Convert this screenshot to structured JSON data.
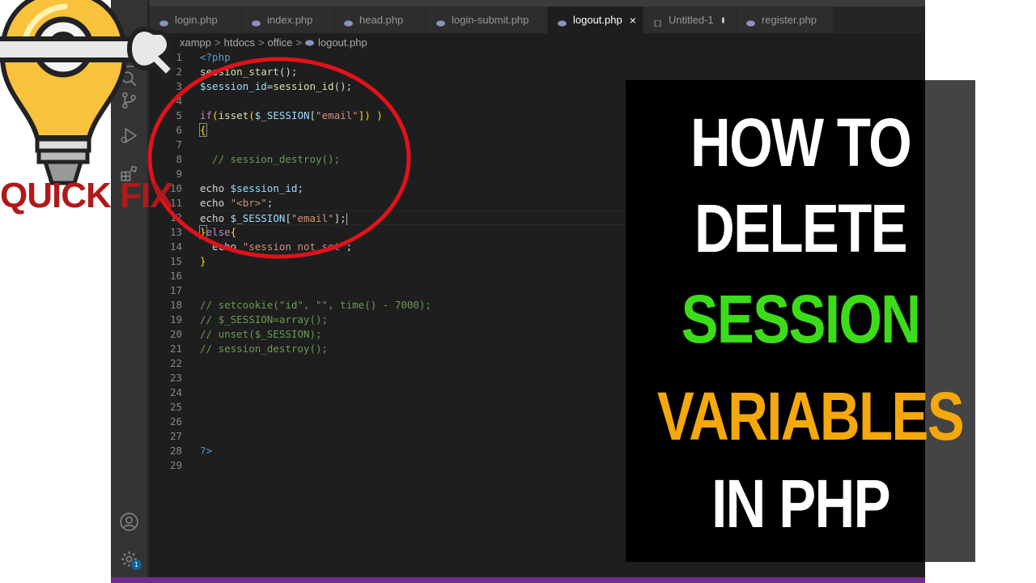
{
  "tabs": [
    {
      "label": "login.php",
      "active": false
    },
    {
      "label": "index.php",
      "active": false
    },
    {
      "label": "head.php",
      "active": false
    },
    {
      "label": "login-submit.php",
      "active": false
    },
    {
      "label": "logout.php",
      "active": true,
      "close": "×"
    },
    {
      "label": "Untitled-1",
      "active": false,
      "dirty": true
    },
    {
      "label": "register.php",
      "active": false
    }
  ],
  "breadcrumb": {
    "items": [
      "xampp",
      "htdocs",
      "office",
      "logout.php"
    ],
    "separator": ">"
  },
  "line_numbers": [
    "1",
    "2",
    "3",
    "4",
    "5",
    "6",
    "7",
    "8",
    "9",
    "10",
    "11",
    "12",
    "13",
    "14",
    "15",
    "16",
    "17",
    "18",
    "19",
    "20",
    "21",
    "22",
    "23",
    "24",
    "25",
    "26",
    "27",
    "28",
    "29"
  ],
  "code": {
    "l1": [
      "<?php"
    ],
    "l2": [
      "session_start",
      "();"
    ],
    "l3": [
      "$session_id",
      "=",
      "session_id",
      "();"
    ],
    "l5": [
      "if",
      "(",
      "isset",
      "(",
      "$_SESSION",
      "[",
      "\"email\"",
      "]) )"
    ],
    "l6": [
      "{"
    ],
    "l8": [
      "  // session_destroy();"
    ],
    "l10": [
      "echo ",
      "$session_id",
      ";"
    ],
    "l11": [
      "echo ",
      "\"<br>\"",
      ";"
    ],
    "l12": [
      "echo ",
      "$_SESSION",
      "[",
      "\"email\"",
      "];"
    ],
    "l13": [
      "}",
      "else",
      "{"
    ],
    "l14": [
      "  echo ",
      "\"session not set\"",
      ";"
    ],
    "l15": [
      "}"
    ],
    "l18": [
      "// setcookie(\"id\", \"\", time() - 7000);"
    ],
    "l19": [
      "// $_SESSION=array();"
    ],
    "l20": [
      "// unset($_SESSION);"
    ],
    "l21": [
      "// session_destroy();"
    ],
    "l28": [
      "?>"
    ]
  },
  "activity_icons": [
    "explorer-icon",
    "search-icon",
    "source-control-icon",
    "run-debug-icon",
    "extensions-icon",
    "account-icon",
    "settings-gear-icon"
  ],
  "settings_badge": "1",
  "thumbnail": {
    "logo_text": "QUICK FIX",
    "title_lines": [
      {
        "text": "HOW TO",
        "color": "#ffffff"
      },
      {
        "text": "DELETE",
        "color": "#ffffff"
      },
      {
        "text": "SESSION",
        "color": "#3ddc1a"
      },
      {
        "text": "VARIABLES",
        "color": "#f5a80c"
      },
      {
        "text": "IN PHP",
        "color": "#ffffff"
      }
    ],
    "annotation_color": "#e3111b"
  }
}
